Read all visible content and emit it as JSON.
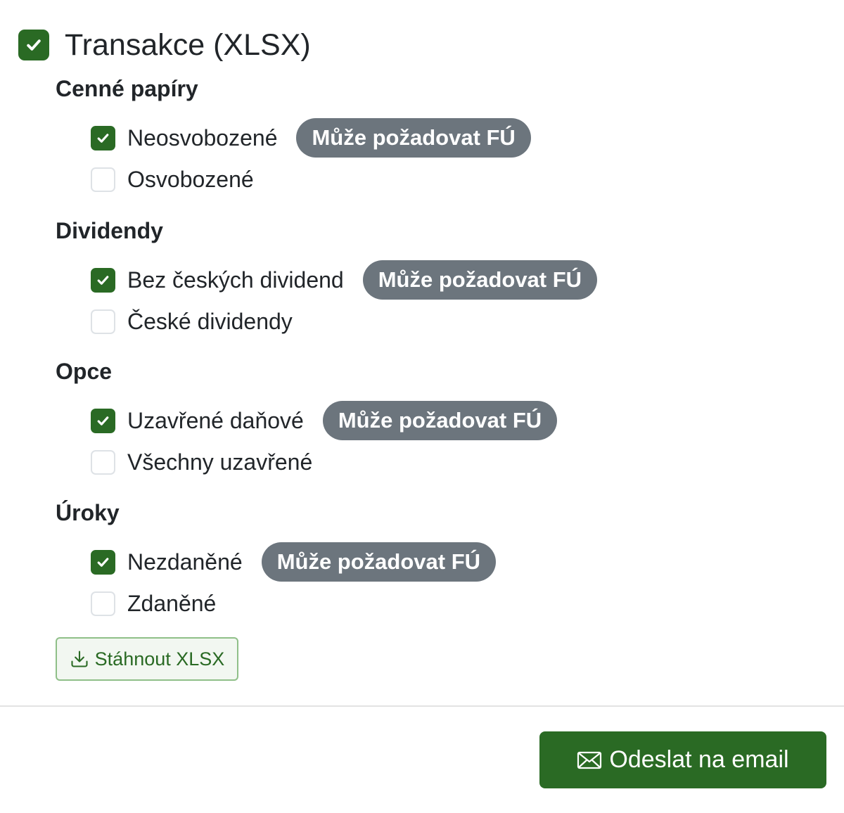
{
  "export": {
    "label": "Transakce (XLSX)",
    "checked": true,
    "groups": [
      {
        "title": "Cenné papíry",
        "options": [
          {
            "label": "Neosvobozené",
            "checked": true,
            "badge": "Může požadovat FÚ"
          },
          {
            "label": "Osvobozené",
            "checked": false
          }
        ]
      },
      {
        "title": "Dividendy",
        "options": [
          {
            "label": "Bez českých dividend",
            "checked": true,
            "badge": "Může požadovat FÚ"
          },
          {
            "label": "České dividendy",
            "checked": false
          }
        ]
      },
      {
        "title": "Opce",
        "options": [
          {
            "label": "Uzavřené daňové",
            "checked": true,
            "badge": "Může požadovat FÚ"
          },
          {
            "label": "Všechny uzavřené",
            "checked": false
          }
        ]
      },
      {
        "title": "Úroky",
        "options": [
          {
            "label": "Nezdaněné",
            "checked": true,
            "badge": "Může požadovat FÚ"
          },
          {
            "label": "Zdaněné",
            "checked": false
          }
        ]
      }
    ],
    "download_label": "Stáhnout XLSX"
  },
  "footer": {
    "send_label": "Odeslat na email"
  },
  "colors": {
    "accent": "#2a6a24",
    "badge": "#6c757d",
    "checkbox_border": "#dee2e6"
  },
  "icons": {
    "check": "check-icon",
    "download": "download-icon",
    "mail": "envelope-icon"
  }
}
